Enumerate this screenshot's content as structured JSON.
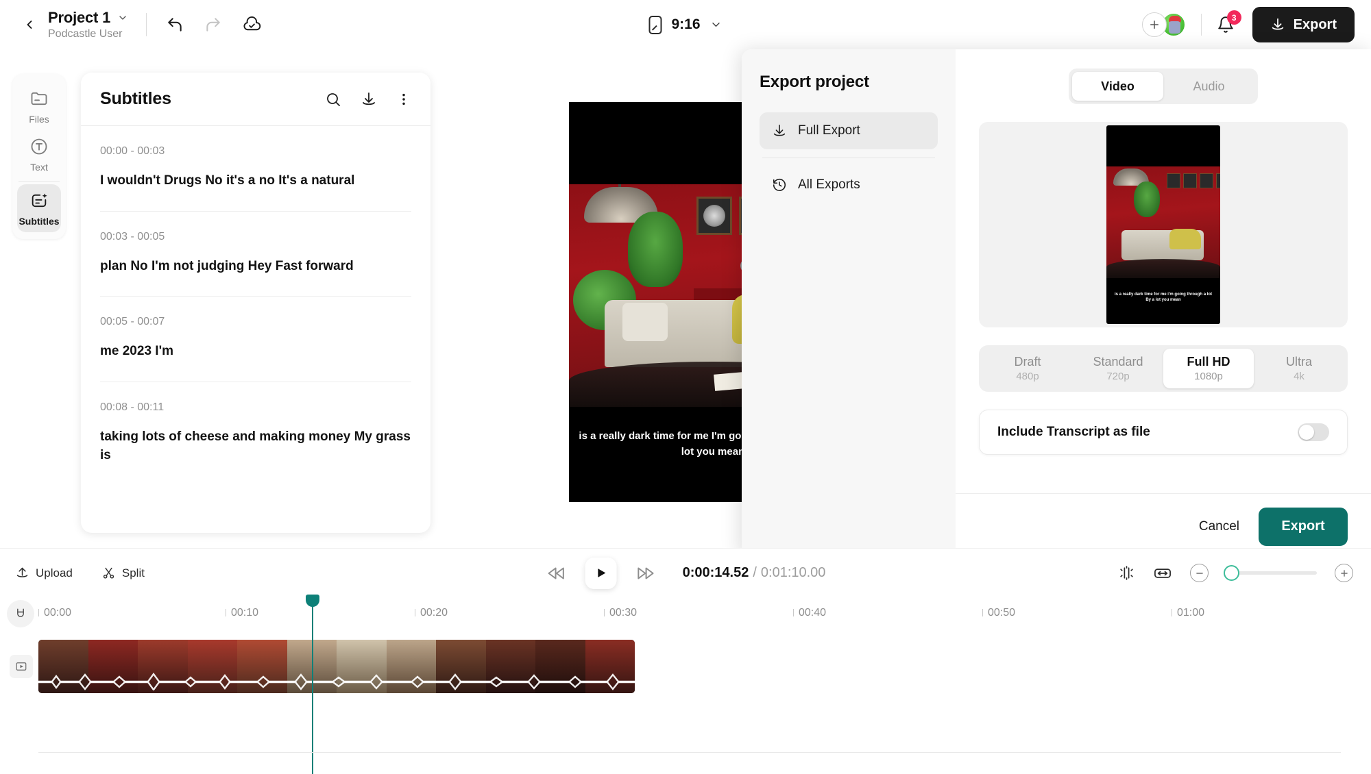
{
  "topbar": {
    "back_icon": "chevron-left-icon",
    "project_title": "Project 1",
    "project_subtitle": "Podcastle User",
    "dropdown_icon": "chevron-down-icon",
    "undo_icon": "undo-icon",
    "redo_icon": "redo-icon",
    "cloud_saved_icon": "cloud-check-icon",
    "device_icon": "phone-icon",
    "duration_badge": "9:16",
    "aspect_dropdown_icon": "chevron-down-icon",
    "add_collaborator_icon": "plus-icon",
    "avatar": "user-avatar",
    "bell_icon": "bell-icon",
    "notification_count": "3",
    "export_label": "Export",
    "export_icon": "download-icon"
  },
  "rail": {
    "items": [
      {
        "label": "Files",
        "icon": "folder-icon",
        "active": false
      },
      {
        "label": "Text",
        "icon": "text-circle-icon",
        "active": false
      },
      {
        "label": "Subtitles",
        "icon": "subtitles-sparkle-icon",
        "active": true
      }
    ]
  },
  "subtitles_panel": {
    "title": "Subtitles",
    "search_icon": "search-icon",
    "download_icon": "download-icon",
    "more_icon": "more-vertical-icon",
    "items": [
      {
        "time": "00:00 - 00:03",
        "text": "I wouldn't Drugs No it's a no It's a natural"
      },
      {
        "time": "00:03 - 00:05",
        "text": "plan No I'm not judging Hey Fast forward"
      },
      {
        "time": "00:05 - 00:07",
        "text": "me 2023 I'm"
      },
      {
        "time": "00:08 - 00:11",
        "text": "taking lots of cheese and making money My grass is"
      }
    ]
  },
  "preview": {
    "caption": "is a really dark time for me I'm going through a lot By a lot you mean"
  },
  "export_modal": {
    "title": "Export project",
    "nav": [
      {
        "label": "Full Export",
        "icon": "download-icon",
        "active": true
      },
      {
        "label": "All Exports",
        "icon": "history-clock-icon",
        "active": false
      }
    ],
    "tabs": [
      {
        "label": "Video",
        "active": true
      },
      {
        "label": "Audio",
        "active": false
      }
    ],
    "thumbnail_caption": "is a really dark time for me i'm going through a lot By a lot you mean",
    "quality_options": [
      {
        "name": "Draft",
        "sub": "480p",
        "active": false
      },
      {
        "name": "Standard",
        "sub": "720p",
        "active": false
      },
      {
        "name": "Full HD",
        "sub": "1080p",
        "active": true
      },
      {
        "name": "Ultra",
        "sub": "4k",
        "active": false
      }
    ],
    "transcript_label": "Include Transcript as file",
    "transcript_enabled": false,
    "cancel_label": "Cancel",
    "export_label": "Export",
    "accent_color": "#0d7169"
  },
  "timeline": {
    "upload_label": "Upload",
    "upload_icon": "upload-icon",
    "split_label": "Split",
    "split_icon": "scissors-icon",
    "rewind_icon": "rewind-icon",
    "play_icon": "play-icon",
    "forward_icon": "fast-forward-icon",
    "current_time": "0:00:14.52",
    "time_separator": "/",
    "total_time": "0:01:10.00",
    "magnet_icon": "magnet-icon",
    "snap_icon": "snap-icon",
    "fit_icon": "fit-to-screen-icon",
    "zoom_out_icon": "minus-icon",
    "zoom_in_icon": "plus-icon",
    "zoom_value": "0",
    "track_icon": "video-track-icon",
    "ruler_ticks": [
      "00:00",
      "00:10",
      "00:20",
      "00:30",
      "00:40",
      "00:50",
      "01:00"
    ],
    "playhead_color": "#0d8078"
  }
}
